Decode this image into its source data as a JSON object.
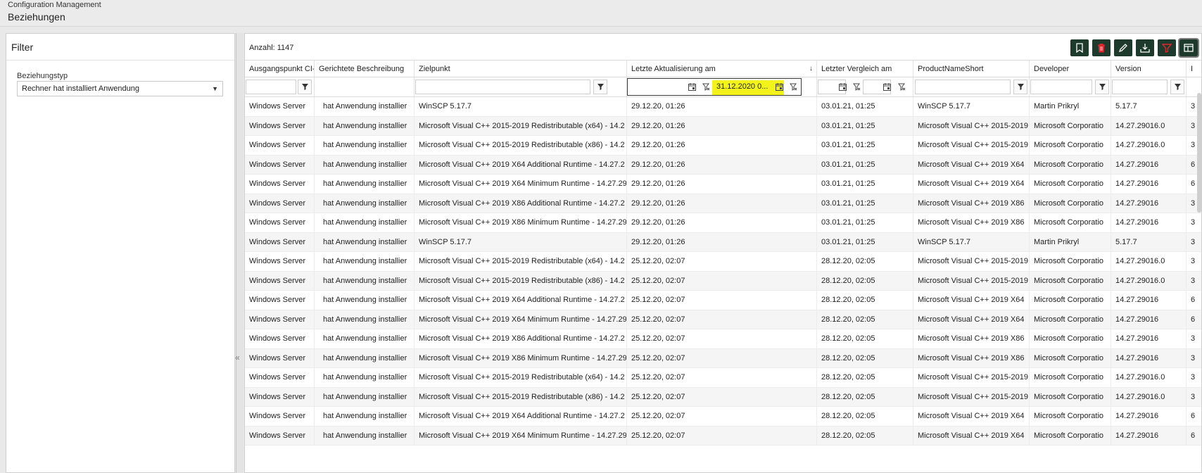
{
  "header": {
    "app_title": "Configuration Management",
    "page_title": "Beziehungen"
  },
  "filter_panel": {
    "title": "Filter",
    "relation_type_label": "Beziehungstyp",
    "relation_type_value": "Rechner hat installiert Anwendung",
    "collapse_icon": "double-chevron-left-icon"
  },
  "grid": {
    "count_text": "Anzahl: 1147",
    "toolbar": [
      "bookmark-icon",
      "delete-icon",
      "edit-icon",
      "download-icon",
      "filter-icon",
      "columns-icon"
    ],
    "columns": [
      "Ausgangspunkt CI-Typ",
      "Gerichtete Beschreibung",
      "Zielpunkt",
      "Letzte Aktualisierung am",
      "Letzter Vergleich am",
      "ProductNameShort",
      "Developer",
      "Version",
      "I"
    ],
    "sort_indicator": "↓",
    "date_filter_value": "31.12.2020 0...",
    "rows": [
      [
        "Windows Server",
        "hat Anwendung installier",
        "WinSCP 5.17.7",
        "29.12.20, 01:26",
        "03.01.21, 01:25",
        "WinSCP 5.17.7",
        "Martin Prikryl",
        "5.17.7",
        "3"
      ],
      [
        "Windows Server",
        "hat Anwendung installier",
        "Microsoft Visual C++ 2015-2019 Redistributable (x64) - 14.2",
        "29.12.20, 01:26",
        "03.01.21, 01:25",
        "Microsoft Visual C++ 2015-2019",
        "Microsoft Corporatio",
        "14.27.29016.0",
        "3"
      ],
      [
        "Windows Server",
        "hat Anwendung installier",
        "Microsoft Visual C++ 2015-2019 Redistributable (x86) - 14.2",
        "29.12.20, 01:26",
        "03.01.21, 01:25",
        "Microsoft Visual C++ 2015-2019",
        "Microsoft Corporatio",
        "14.27.29016.0",
        "3"
      ],
      [
        "Windows Server",
        "hat Anwendung installier",
        "Microsoft Visual C++ 2019 X64 Additional Runtime - 14.27.2",
        "29.12.20, 01:26",
        "03.01.21, 01:25",
        "Microsoft Visual C++ 2019 X64",
        "Microsoft Corporatio",
        "14.27.29016",
        "6"
      ],
      [
        "Windows Server",
        "hat Anwendung installier",
        "Microsoft Visual C++ 2019 X64 Minimum Runtime - 14.27.29",
        "29.12.20, 01:26",
        "03.01.21, 01:25",
        "Microsoft Visual C++ 2019 X64",
        "Microsoft Corporatio",
        "14.27.29016",
        "6"
      ],
      [
        "Windows Server",
        "hat Anwendung installier",
        "Microsoft Visual C++ 2019 X86 Additional Runtime - 14.27.2",
        "29.12.20, 01:26",
        "03.01.21, 01:25",
        "Microsoft Visual C++ 2019 X86",
        "Microsoft Corporatio",
        "14.27.29016",
        "3"
      ],
      [
        "Windows Server",
        "hat Anwendung installier",
        "Microsoft Visual C++ 2019 X86 Minimum Runtime - 14.27.29",
        "29.12.20, 01:26",
        "03.01.21, 01:25",
        "Microsoft Visual C++ 2019 X86",
        "Microsoft Corporatio",
        "14.27.29016",
        "3"
      ],
      [
        "Windows Server",
        "hat Anwendung installier",
        "WinSCP 5.17.7",
        "29.12.20, 01:26",
        "03.01.21, 01:25",
        "WinSCP 5.17.7",
        "Martin Prikryl",
        "5.17.7",
        "3"
      ],
      [
        "Windows Server",
        "hat Anwendung installier",
        "Microsoft Visual C++ 2015-2019 Redistributable (x64) - 14.2",
        "25.12.20, 02:07",
        "28.12.20, 02:05",
        "Microsoft Visual C++ 2015-2019",
        "Microsoft Corporatio",
        "14.27.29016.0",
        "3"
      ],
      [
        "Windows Server",
        "hat Anwendung installier",
        "Microsoft Visual C++ 2015-2019 Redistributable (x86) - 14.2",
        "25.12.20, 02:07",
        "28.12.20, 02:05",
        "Microsoft Visual C++ 2015-2019",
        "Microsoft Corporatio",
        "14.27.29016.0",
        "3"
      ],
      [
        "Windows Server",
        "hat Anwendung installier",
        "Microsoft Visual C++ 2019 X64 Additional Runtime - 14.27.2",
        "25.12.20, 02:07",
        "28.12.20, 02:05",
        "Microsoft Visual C++ 2019 X64",
        "Microsoft Corporatio",
        "14.27.29016",
        "6"
      ],
      [
        "Windows Server",
        "hat Anwendung installier",
        "Microsoft Visual C++ 2019 X64 Minimum Runtime - 14.27.29",
        "25.12.20, 02:07",
        "28.12.20, 02:05",
        "Microsoft Visual C++ 2019 X64",
        "Microsoft Corporatio",
        "14.27.29016",
        "6"
      ],
      [
        "Windows Server",
        "hat Anwendung installier",
        "Microsoft Visual C++ 2019 X86 Additional Runtime - 14.27.2",
        "25.12.20, 02:07",
        "28.12.20, 02:05",
        "Microsoft Visual C++ 2019 X86",
        "Microsoft Corporatio",
        "14.27.29016",
        "3"
      ],
      [
        "Windows Server",
        "hat Anwendung installier",
        "Microsoft Visual C++ 2019 X86 Minimum Runtime - 14.27.29",
        "25.12.20, 02:07",
        "28.12.20, 02:05",
        "Microsoft Visual C++ 2019 X86",
        "Microsoft Corporatio",
        "14.27.29016",
        "3"
      ],
      [
        "Windows Server",
        "hat Anwendung installier",
        "Microsoft Visual C++ 2015-2019 Redistributable (x64) - 14.2",
        "25.12.20, 02:07",
        "28.12.20, 02:05",
        "Microsoft Visual C++ 2015-2019",
        "Microsoft Corporatio",
        "14.27.29016.0",
        "3"
      ],
      [
        "Windows Server",
        "hat Anwendung installier",
        "Microsoft Visual C++ 2015-2019 Redistributable (x86) - 14.2",
        "25.12.20, 02:07",
        "28.12.20, 02:05",
        "Microsoft Visual C++ 2015-2019",
        "Microsoft Corporatio",
        "14.27.29016.0",
        "3"
      ],
      [
        "Windows Server",
        "hat Anwendung installier",
        "Microsoft Visual C++ 2019 X64 Additional Runtime - 14.27.2",
        "25.12.20, 02:07",
        "28.12.20, 02:05",
        "Microsoft Visual C++ 2019 X64",
        "Microsoft Corporatio",
        "14.27.29016",
        "6"
      ],
      [
        "Windows Server",
        "hat Anwendung installier",
        "Microsoft Visual C++ 2019 X64 Minimum Runtime - 14.27.29",
        "25.12.20, 02:07",
        "28.12.20, 02:05",
        "Microsoft Visual C++ 2019 X64",
        "Microsoft Corporatio",
        "14.27.29016",
        "6"
      ]
    ]
  },
  "colors": {
    "toolbar_bg": "#1d3a2c",
    "delete_icon": "#e0262d",
    "filter_icon": "#e0262d",
    "highlight": "#f3f31b"
  }
}
